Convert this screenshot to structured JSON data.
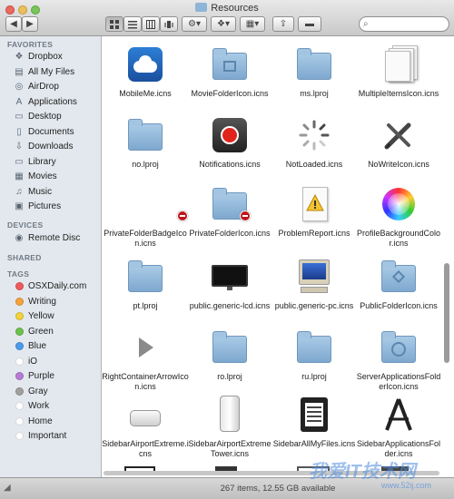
{
  "window": {
    "title": "Resources",
    "search_placeholder": "",
    "status": "267 items, 12.55 GB available"
  },
  "toolbar": {
    "back": "◀",
    "forward": "▶",
    "views": [
      "icons",
      "list",
      "columns",
      "cover-flow"
    ],
    "action": "⚙▾",
    "dropbox": "Dropbox▾",
    "arrange": "▦▾",
    "share": "share",
    "tags": "tags"
  },
  "sidebar": {
    "favorites_heading": "FAVORITES",
    "favorites": [
      {
        "label": "Dropbox",
        "icon": "dropbox-icon"
      },
      {
        "label": "All My Files",
        "icon": "all-files-icon"
      },
      {
        "label": "AirDrop",
        "icon": "airdrop-icon"
      },
      {
        "label": "Applications",
        "icon": "applications-icon"
      },
      {
        "label": "Desktop",
        "icon": "desktop-icon"
      },
      {
        "label": "Documents",
        "icon": "documents-icon"
      },
      {
        "label": "Downloads",
        "icon": "downloads-icon"
      },
      {
        "label": "Library",
        "icon": "library-icon"
      },
      {
        "label": "Movies",
        "icon": "movies-icon"
      },
      {
        "label": "Music",
        "icon": "music-icon"
      },
      {
        "label": "Pictures",
        "icon": "pictures-icon"
      }
    ],
    "devices_heading": "DEVICES",
    "devices": [
      {
        "label": "Remote Disc",
        "icon": "remote-disc-icon"
      }
    ],
    "shared_heading": "SHARED",
    "tags_heading": "TAGS",
    "tags": [
      {
        "label": "OSXDaily.com",
        "color": "#ef5a5a"
      },
      {
        "label": "Writing",
        "color": "#f5a33a"
      },
      {
        "label": "Yellow",
        "color": "#f2d33b"
      },
      {
        "label": "Green",
        "color": "#6cc24a"
      },
      {
        "label": "Blue",
        "color": "#4a9be8"
      },
      {
        "label": "iO",
        "color": "#ffffff"
      },
      {
        "label": "Purple",
        "color": "#b67bd4"
      },
      {
        "label": "Gray",
        "color": "#a0a0a0"
      },
      {
        "label": "Work",
        "color": "#ffffff"
      },
      {
        "label": "Home",
        "color": "#ffffff"
      },
      {
        "label": "Important",
        "color": "#ffffff"
      }
    ]
  },
  "files": [
    {
      "name": "MobileMe.icns",
      "icon": "mobileme-cloud-icon"
    },
    {
      "name": "MovieFolderIcon.icns",
      "icon": "movie-folder-icon"
    },
    {
      "name": "ms.lproj",
      "icon": "folder-icon"
    },
    {
      "name": "MultipleItemsIcon.icns",
      "icon": "multiple-items-icon"
    },
    {
      "name": "no.lproj",
      "icon": "folder-icon"
    },
    {
      "name": "Notifications.icns",
      "icon": "notifications-icon"
    },
    {
      "name": "NotLoaded.icns",
      "icon": "not-loaded-icon"
    },
    {
      "name": "NoWriteIcon.icns",
      "icon": "no-write-icon"
    },
    {
      "name": "PrivateFolderBadgeIcon.icns",
      "icon": "private-badge-icon"
    },
    {
      "name": "PrivateFolderIcon.icns",
      "icon": "private-folder-icon"
    },
    {
      "name": "ProblemReport.icns",
      "icon": "problem-report-icon"
    },
    {
      "name": "ProfileBackgroundColor.icns",
      "icon": "color-wheel-icon"
    },
    {
      "name": "pt.lproj",
      "icon": "folder-icon"
    },
    {
      "name": "public.generic-lcd.icns",
      "icon": "lcd-display-icon"
    },
    {
      "name": "public.generic-pc.icns",
      "icon": "generic-pc-icon"
    },
    {
      "name": "PublicFolderIcon.icns",
      "icon": "public-folder-icon"
    },
    {
      "name": "RightContainerArrowIcon.icns",
      "icon": "right-arrow-icon"
    },
    {
      "name": "ro.lproj",
      "icon": "folder-icon"
    },
    {
      "name": "ru.lproj",
      "icon": "folder-icon"
    },
    {
      "name": "ServerApplicationsFolderIcon.icns",
      "icon": "server-apps-folder-icon"
    },
    {
      "name": "SidebarAirportExtreme.icns",
      "icon": "airport-extreme-icon"
    },
    {
      "name": "SidebarAirportExtremeTower.icns",
      "icon": "airport-tower-icon"
    },
    {
      "name": "SidebarAllMyFiles.icns",
      "icon": "all-my-files-icon"
    },
    {
      "name": "SidebarApplicationsFolder.icns",
      "icon": "applications-folder-icon"
    }
  ],
  "watermark": {
    "main": "我爱IT技术网",
    "sub": "www.52ij.com"
  }
}
